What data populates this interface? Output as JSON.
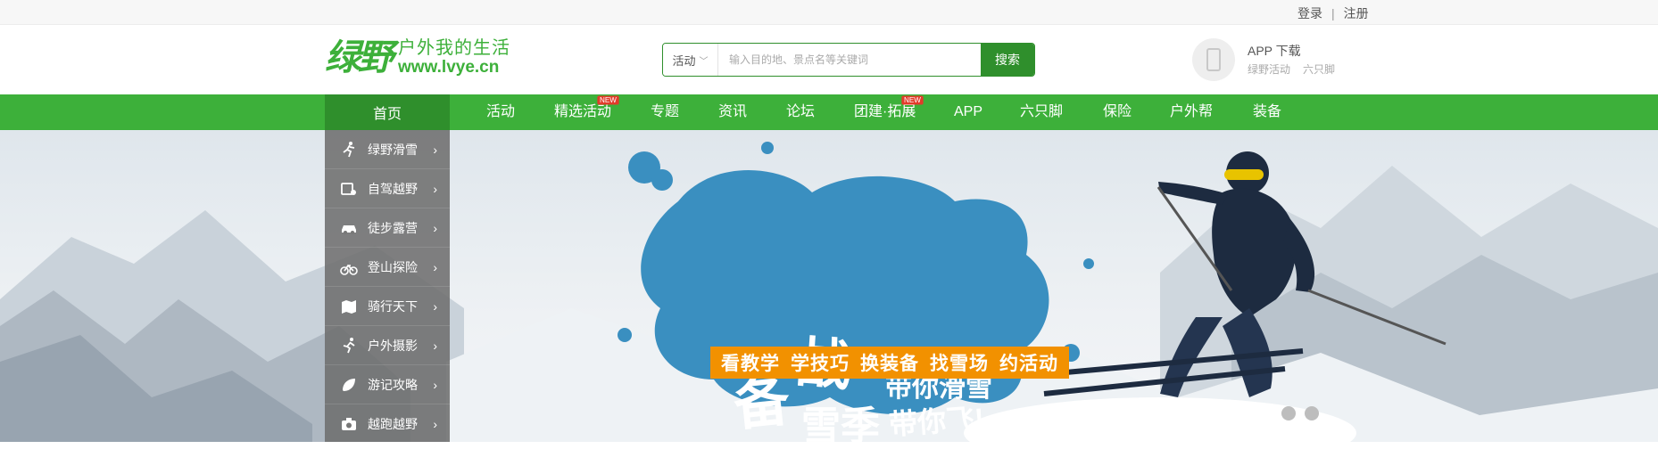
{
  "topbar": {
    "login": "登录",
    "sep": "|",
    "register": "注册"
  },
  "header": {
    "logo_mark": "绿野",
    "logo_slogan": "户外我的生活",
    "logo_url": "www.lvye.cn",
    "search": {
      "category": "活动",
      "placeholder": "输入目的地、景点名等关键词",
      "button": "搜索"
    },
    "app": {
      "title": "APP 下载",
      "links": [
        "绿野活动",
        "六只脚"
      ]
    }
  },
  "nav": {
    "home": "首页",
    "items": [
      {
        "label": "活动",
        "badge": ""
      },
      {
        "label": "精选活动",
        "badge": "NEW"
      },
      {
        "label": "专题",
        "badge": ""
      },
      {
        "label": "资讯",
        "badge": ""
      },
      {
        "label": "论坛",
        "badge": ""
      },
      {
        "label": "团建·拓展",
        "badge": "NEW"
      },
      {
        "label": "APP",
        "badge": ""
      },
      {
        "label": "六只脚",
        "badge": ""
      },
      {
        "label": "保险",
        "badge": ""
      },
      {
        "label": "户外帮",
        "badge": ""
      },
      {
        "label": "装备",
        "badge": ""
      }
    ]
  },
  "side_menu": [
    {
      "label": "绿野滑雪",
      "icon": "skier-icon"
    },
    {
      "label": "自驾越野",
      "icon": "jeep-icon"
    },
    {
      "label": "徒步露营",
      "icon": "car-icon"
    },
    {
      "label": "登山探险",
      "icon": "bicycle-icon"
    },
    {
      "label": "骑行天下",
      "icon": "map-icon"
    },
    {
      "label": "户外摄影",
      "icon": "runner-icon"
    },
    {
      "label": "游记攻略",
      "icon": "leaf-icon"
    },
    {
      "label": "越跑越野",
      "icon": "camera-icon"
    }
  ],
  "banner": {
    "title_a": "备",
    "title_b": "战",
    "title_c": "雪季",
    "tag_1": "带你滑雪",
    "tag_2": "带你飞!",
    "strip": [
      "看教学",
      "学技巧",
      "换装备",
      "找雪场",
      "约活动"
    ],
    "slides": 3,
    "active_slide": 1
  },
  "colors": {
    "green": "#3db03a",
    "dark_green": "#2f8f2c",
    "orange": "#f29100",
    "splash": "#3a8fc0"
  }
}
